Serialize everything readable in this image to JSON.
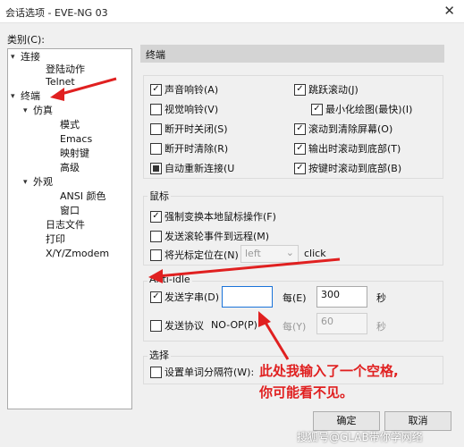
{
  "window": {
    "title": "会话选项 - EVE-NG 03",
    "close_glyph": "✕"
  },
  "category_label": "类别(C):",
  "tree": {
    "connection": "连接",
    "logon_actions": "登陆动作",
    "telnet": "Telnet",
    "terminal": "终端",
    "emulation": "仿真",
    "modes": "模式",
    "emacs": "Emacs",
    "mapped_keys": "映射键",
    "advanced": "高级",
    "appearance": "外观",
    "ansi_color": "ANSI 颜色",
    "window": "窗口",
    "log_file": "日志文件",
    "printing": "打印",
    "xyzmodem": "X/Y/Zmodem",
    "expand_glyph": "▸",
    "collapse_glyph": "▾"
  },
  "panel": {
    "header": "终端",
    "options": [
      "声音响铃(A)",
      "视觉响铃(V)",
      "断开时关闭(S)",
      "断开时清除(R)",
      "自动重新连接(U",
      "跳跃滚动(J)",
      "最小化绘图(最快)(I)",
      "滚动到清除屏幕(O)",
      "输出时滚动到底部(T)",
      "按键时滚动到底部(B)"
    ],
    "mouse": {
      "title": "鼠标",
      "force_local": "强制变换本地鼠标操作(F)",
      "send_wheel": "发送滚轮事件到远程(M)",
      "position_cursor": "将光标定位在(N)",
      "select_value": "left",
      "select_arrow": "⌄",
      "click": "click"
    },
    "anti_idle": {
      "title": "Anti-idle",
      "send_string": "发送字串(D)",
      "string_value": "",
      "every_label": "每(E)",
      "every_value": "300",
      "unit": "秒",
      "send_protocol": "发送协议",
      "protocol_value": "NO-OP(P)",
      "every2_label": "每(Y)",
      "every2_value": "60",
      "unit2": "秒"
    },
    "select_group": {
      "title": "选择",
      "word_delim": "设置单词分隔符(W):"
    }
  },
  "annotation": {
    "line1": "此处我输入了一个空格,",
    "line2": "你可能看不见。"
  },
  "buttons": {
    "ok": "确定",
    "cancel": "取消"
  },
  "watermark": "搜狐号@GLAB带你学网络",
  "check_glyph": "✓",
  "colors": {
    "annotation": "#e02020",
    "focus": "#1a73d9"
  }
}
